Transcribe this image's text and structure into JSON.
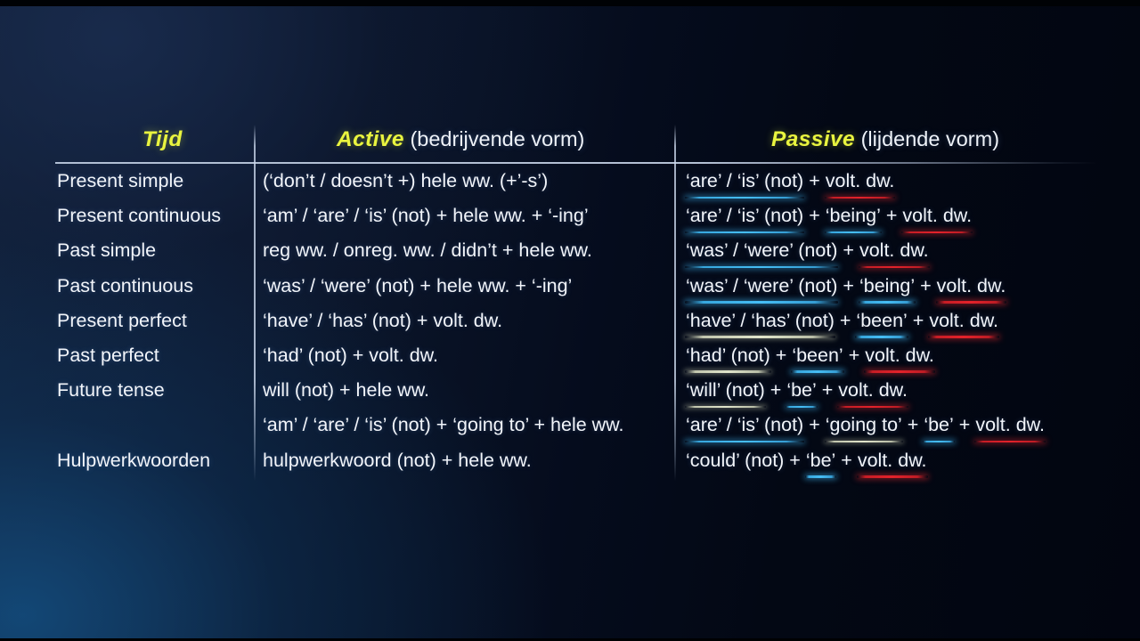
{
  "header": {
    "tijd_accent": "Tijd",
    "active_accent": "Active",
    "active_note": " (bedrijvende vorm)",
    "passive_accent": "Passive",
    "passive_note": " (lijdende vorm)"
  },
  "colors": {
    "accent_yellow": "#e9f43f",
    "text_white": "#f2f5fa",
    "underline_blue": "#46beF5",
    "underline_red": "#e4222a",
    "underline_pale": "#ecf0d4",
    "rule": "#cddaee"
  },
  "rows": [
    {
      "tense": "Present simple",
      "active": "(‘don’t / doesn’t +) hele ww. (+’-s’)",
      "passive_parts": [
        {
          "text": "‘are’ / ‘is’ (not)",
          "mark": "blue"
        },
        {
          "text": " + ",
          "mark": "none"
        },
        {
          "text": "volt. dw.",
          "mark": "red"
        }
      ]
    },
    {
      "tense": "Present continuous",
      "active": "‘am’ / ‘are’ / ‘is’ (not) + hele ww. + ‘-ing’",
      "passive_parts": [
        {
          "text": "‘are’ / ‘is’ (not)",
          "mark": "blue"
        },
        {
          "text": " + ",
          "mark": "none"
        },
        {
          "text": "‘being’",
          "mark": "blue"
        },
        {
          "text": " + ",
          "mark": "none"
        },
        {
          "text": "volt. dw.",
          "mark": "red"
        }
      ]
    },
    {
      "tense": "Past simple",
      "active": "reg ww. / onreg. ww. / didn’t + hele ww.",
      "passive_parts": [
        {
          "text": "‘was’ / ‘were’ (not)",
          "mark": "blue"
        },
        {
          "text": " + ",
          "mark": "none"
        },
        {
          "text": "volt. dw.",
          "mark": "red"
        }
      ]
    },
    {
      "tense": "Past continuous",
      "active": "‘was’ / ‘were’ (not) + hele ww. + ‘-ing’",
      "passive_parts": [
        {
          "text": "‘was’ / ‘were’ (not)",
          "mark": "blue"
        },
        {
          "text": " + ",
          "mark": "none"
        },
        {
          "text": "‘being’",
          "mark": "blue"
        },
        {
          "text": " + ",
          "mark": "none"
        },
        {
          "text": "volt. dw.",
          "mark": "red"
        }
      ]
    },
    {
      "tense": "Present perfect",
      "active": "‘have’ / ‘has’ (not) + volt. dw.",
      "passive_parts": [
        {
          "text": "‘have’ / ‘has’ (not)",
          "mark": "pale"
        },
        {
          "text": " + ",
          "mark": "none"
        },
        {
          "text": "‘been’",
          "mark": "blue"
        },
        {
          "text": " + ",
          "mark": "none"
        },
        {
          "text": "volt. dw.",
          "mark": "red"
        }
      ]
    },
    {
      "tense": "Past perfect",
      "active": "‘had’ (not) + volt. dw.",
      "passive_parts": [
        {
          "text": "‘had’ (not)",
          "mark": "pale"
        },
        {
          "text": " + ",
          "mark": "none"
        },
        {
          "text": "‘been’",
          "mark": "blue"
        },
        {
          "text": " + ",
          "mark": "none"
        },
        {
          "text": "volt. dw.",
          "mark": "red"
        }
      ]
    },
    {
      "tense": "Future tense",
      "active": "will (not) + hele ww.",
      "passive_parts": [
        {
          "text": "‘will’ (not)",
          "mark": "pale"
        },
        {
          "text": " + ",
          "mark": "none"
        },
        {
          "text": "‘be’",
          "mark": "blue"
        },
        {
          "text": " + ",
          "mark": "none"
        },
        {
          "text": "volt. dw.",
          "mark": "red"
        }
      ]
    },
    {
      "tense": "",
      "active": "‘am’ / ‘are’ / ‘is’ (not) + ‘going to’ + hele ww.",
      "passive_parts": [
        {
          "text": "‘are’ / ‘is’ (not)",
          "mark": "blue"
        },
        {
          "text": " + ",
          "mark": "none"
        },
        {
          "text": "‘going to’",
          "mark": "pale"
        },
        {
          "text": " + ",
          "mark": "none"
        },
        {
          "text": "‘be’",
          "mark": "blue"
        },
        {
          "text": " + ",
          "mark": "none"
        },
        {
          "text": "volt. dw.",
          "mark": "red"
        }
      ]
    },
    {
      "tense": "Hulpwerkwoorden",
      "active": "hulpwerkwoord (not) + hele ww.",
      "passive_parts": [
        {
          "text": "‘could’ (not) + ",
          "mark": "none"
        },
        {
          "text": "‘be’",
          "mark": "blue"
        },
        {
          "text": " + ",
          "mark": "none"
        },
        {
          "text": "volt. dw.",
          "mark": "red"
        }
      ]
    }
  ]
}
